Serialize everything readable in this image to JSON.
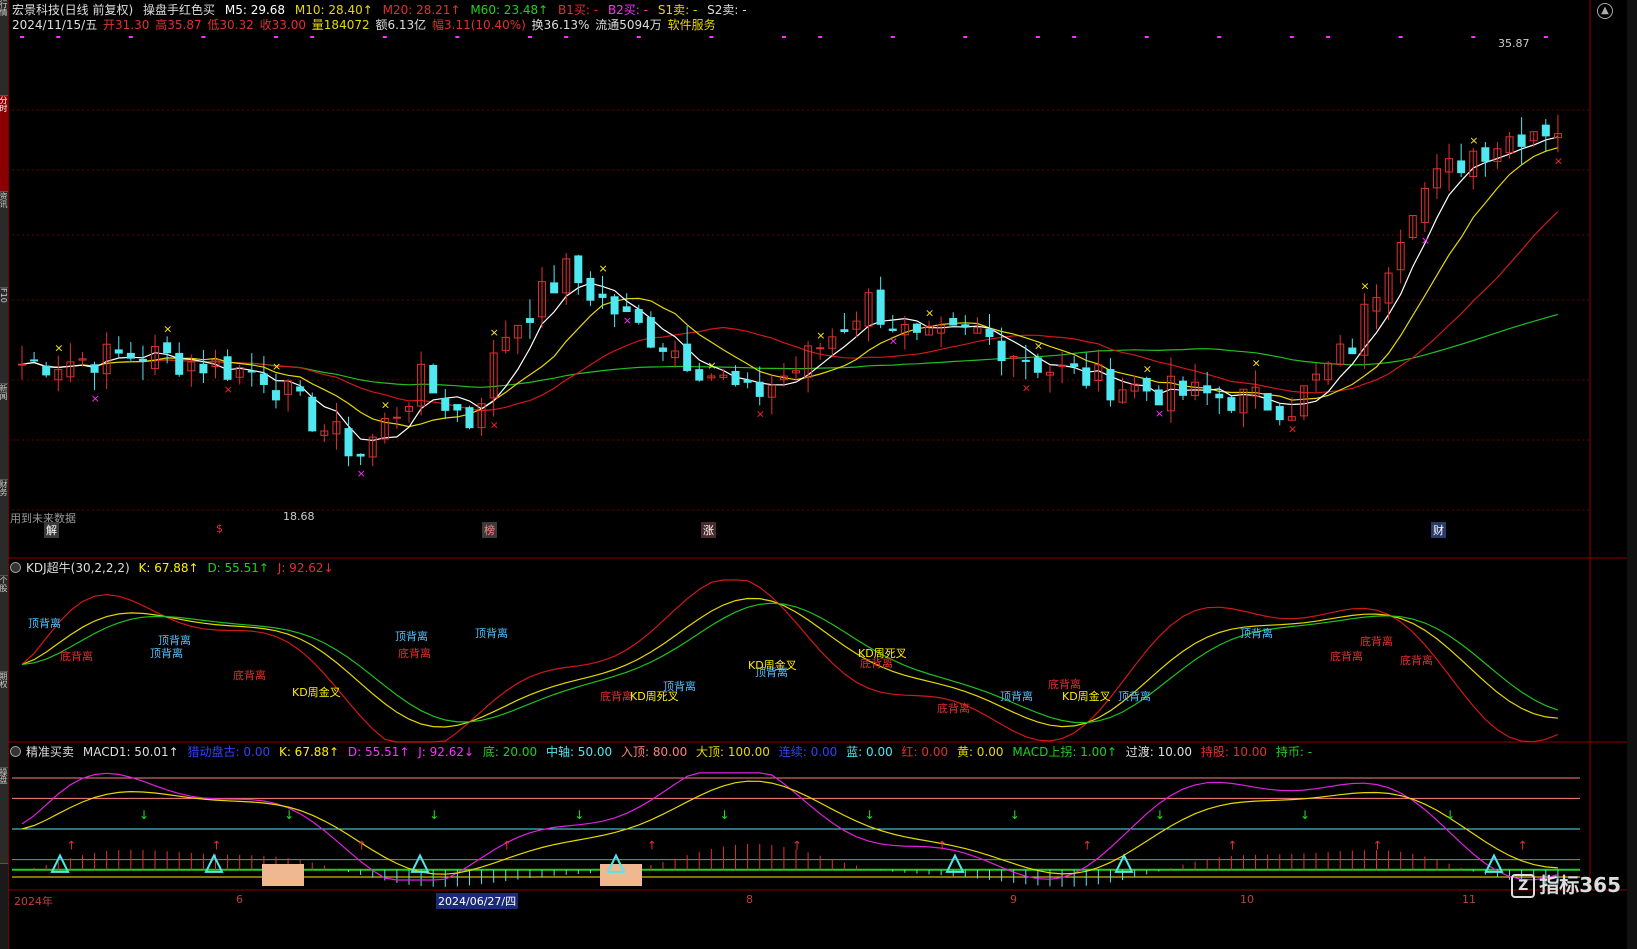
{
  "colors": {
    "up": "#e03030",
    "down": "#50e8f0",
    "ma5": "#ffffff",
    "ma10": "#e6d800",
    "ma20": "#d01818",
    "ma60": "#20c020",
    "magenta": "#ff30ff",
    "grid": "#6a0000"
  },
  "sidebar_tabs": [
    "行情",
    "分时",
    "资讯",
    "F10",
    "新闻",
    "财务",
    "个股",
    "期权",
    "操盘"
  ],
  "header": {
    "title": "宏景科技(日线 前复权)",
    "indicator": "操盘手红色买",
    "m5": "M5: 29.68",
    "m10": "M10: 28.40↑",
    "m20": "M20: 28.21↑",
    "m60": "M60: 23.48↑",
    "b1": "B1买: -",
    "b2": "B2买: -",
    "s1": "S1卖: -",
    "s2": "S2卖: -",
    "date": "2024/11/15/五",
    "open": "开31.30",
    "high": "高35.87",
    "low": "低30.32",
    "close": "收33.00",
    "vol": "量184072",
    "amt": "额6.13亿",
    "chg": "幅3.11(10.40%)",
    "turn": "换36.13%",
    "float": "流通5094万",
    "sector": "软件服务"
  },
  "main_chart": {
    "price_high": "35.87",
    "price_low": "18.68",
    "future_note": "用到未来数据",
    "markers": [
      {
        "t": "解"
      },
      {
        "t": "$"
      },
      {
        "t": "榜"
      },
      {
        "t": "涨"
      },
      {
        "t": "财"
      }
    ]
  },
  "kdj_panel": {
    "title": "KDJ超牛(30,2,2,2)",
    "k": "K: 67.88↑",
    "d": "D: 55.51↑",
    "j": "J: 92.62↓",
    "labels": [
      "顶背离",
      "底背离",
      "顶背离",
      "顶背离",
      "底背离",
      "KD周金叉",
      "顶背离",
      "底背离",
      "顶背离",
      "底背离",
      "KD周死叉",
      "顶背离",
      "KD周金叉",
      "顶背离",
      "KD周死叉",
      "底背离",
      "底背离",
      "顶背离",
      "底背离",
      "KD周金叉",
      "顶背离",
      "顶背离",
      "底背离",
      "底背离",
      "底背离"
    ]
  },
  "bottom_panel": {
    "title": "精准买卖",
    "macd1": "MACD1: 50.01↑",
    "zhu": "猎动盘古: 0.00",
    "k": "K: 67.88↑",
    "d": "D: 55.51↑",
    "j": "J: 92.62↓",
    "di": "底: 20.00",
    "zhongzhou": "中轴: 50.00",
    "ruding": "入顶: 80.00",
    "dading": "大顶: 100.00",
    "lianzhang": "连续: 0.00",
    "lan": "蓝: 0.00",
    "hong": "红: 0.00",
    "huang": "黄: 0.00",
    "macd_up": "MACD上拐: 1.00↑",
    "guodu": "过渡: 10.00",
    "chigu": "持股: 10.00",
    "chibi": "持币: -"
  },
  "xaxis": {
    "labels": [
      "2024年",
      "6",
      "2024/06/27/四",
      "8",
      "9",
      "10",
      "11"
    ]
  },
  "brand": "指标365"
}
